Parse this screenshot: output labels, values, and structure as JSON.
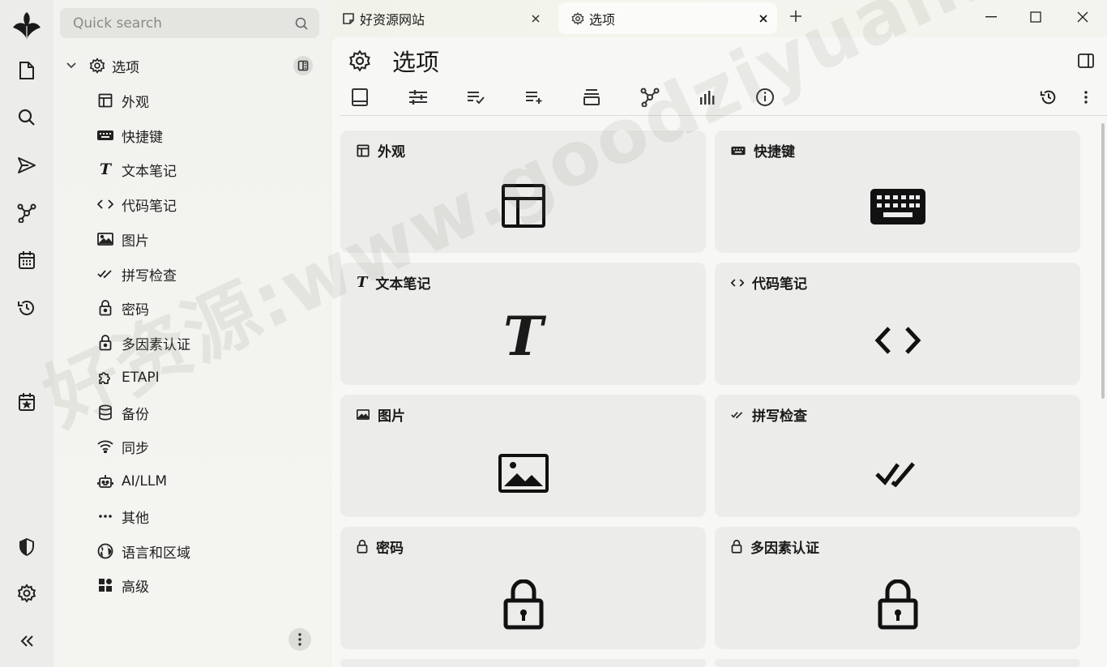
{
  "search": {
    "placeholder": "Quick search"
  },
  "tree": {
    "root_label": "选项",
    "items": [
      {
        "label": "外观",
        "icon": "layout-icon"
      },
      {
        "label": "快捷键",
        "icon": "keyboard-icon"
      },
      {
        "label": "文本笔记",
        "icon": "text-t-icon"
      },
      {
        "label": "代码笔记",
        "icon": "code-icon"
      },
      {
        "label": "图片",
        "icon": "image-icon"
      },
      {
        "label": "拼写检查",
        "icon": "double-check-icon"
      },
      {
        "label": "密码",
        "icon": "lock-icon"
      },
      {
        "label": "多因素认证",
        "icon": "lock-icon"
      },
      {
        "label": "ETAPI",
        "icon": "puzzle-icon"
      },
      {
        "label": "备份",
        "icon": "database-icon"
      },
      {
        "label": "同步",
        "icon": "wifi-icon"
      },
      {
        "label": "AI/LLM",
        "icon": "robot-icon"
      },
      {
        "label": "其他",
        "icon": "dots-icon"
      },
      {
        "label": "语言和区域",
        "icon": "globe-icon"
      },
      {
        "label": "高级",
        "icon": "grid-icon"
      }
    ]
  },
  "tabs": [
    {
      "label": "好资源网站"
    },
    {
      "label": "选项"
    }
  ],
  "page": {
    "title": "选项"
  },
  "cards": [
    {
      "label": "外观"
    },
    {
      "label": "快捷键"
    },
    {
      "label": "文本笔记"
    },
    {
      "label": "代码笔记"
    },
    {
      "label": "图片"
    },
    {
      "label": "拼写检查"
    },
    {
      "label": "密码"
    },
    {
      "label": "多因素认证"
    }
  ],
  "watermark": "好资源:www.goodziyuan.com",
  "colors": {
    "accent": "#1a1a1a",
    "card": "#ececea",
    "sidebar": "#f2f2ee"
  }
}
